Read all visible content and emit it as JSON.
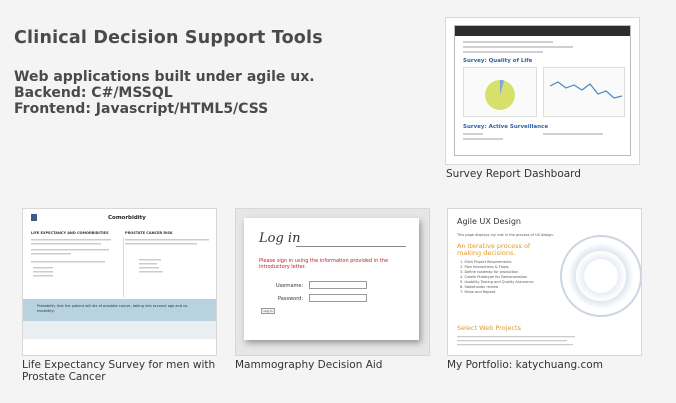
{
  "header": {
    "title": "Clinical Decision Support Tools",
    "description": [
      "Web applications built under agile ux.",
      "Backend: C#/MSSQL",
      "Frontend: Javascript/HTML5/CSS"
    ]
  },
  "projects": [
    {
      "caption": "Survey Report Dashboard",
      "preview": {
        "heading1": "Survey: Quality of Life",
        "heading2": "Survey: Active Surveillance"
      }
    },
    {
      "caption_line1": "Life Expectancy Survey for men with",
      "caption_line2": "Prostate Cancer",
      "preview": {
        "title": "Comorbidity",
        "left_heading": "LIFE EXPECTANCY AND COMORBIDITIES",
        "right_heading": "PROSTATE CANCER RISK",
        "band_text": "Probability that the patient will die of prostate cancer, taking into account age and co-morbidity:"
      }
    },
    {
      "caption": "Mammography Decision Aid",
      "preview": {
        "login_title": "Log in",
        "message": "Please sign in using the information provided in the introductory letter.",
        "username_label": "Username:",
        "password_label": "Password:",
        "button_label": "Log in"
      }
    },
    {
      "caption": "My Portfolio: katychuang.com",
      "preview": {
        "title": "Agile UX Design",
        "subtitle": "This page displays my role in the process of UX design.",
        "orange_heading": "An iterative process of making decisions.",
        "orange_heading2": "Select Web Projects",
        "steps": [
          "1. Elicit Project Requirements",
          "2. Plan Interactions & Flows",
          "3. Define roadmap for production",
          "4. Create Prototype for Demonstration",
          "5. Usability Testing and Quality Assurance",
          "6. Stakeholder review",
          "7. Rinse and Repeat"
        ]
      }
    }
  ],
  "colors": {
    "background": "#f4f4f4",
    "text": "#4a4a4a",
    "accent_blue": "#2c5fa3",
    "accent_orange": "#e29b2a",
    "error_red": "#c0202a"
  }
}
